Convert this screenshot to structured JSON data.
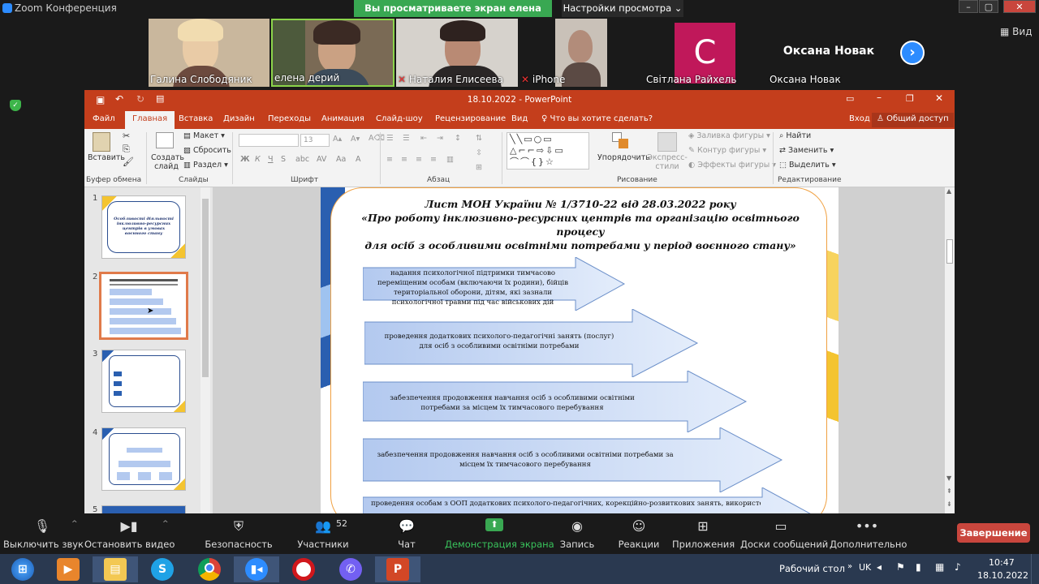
{
  "zoom": {
    "window_title": "Zoom Конференция",
    "share_banner": "Вы просматриваете экран елена дерий",
    "view_settings": "Настройки просмотра ⌄",
    "view_toggle": "Вид",
    "participants": [
      {
        "name": "Галина Слободяник"
      },
      {
        "name": "елена дерий"
      },
      {
        "name": "Наталия Елисеева"
      },
      {
        "name": "iPhone"
      },
      {
        "name": "Світлана Райхель",
        "initial": "С"
      },
      {
        "name": "Оксана Новак",
        "display_name": "Оксана Новак"
      }
    ],
    "toolbar": {
      "mute": "Выключить звук",
      "video": "Остановить видео",
      "security": "Безопасность",
      "participants": "Участники",
      "participants_count": "52",
      "chat": "Чат",
      "share": "Демонстрация экрана",
      "record": "Запись",
      "reactions": "Реакции",
      "apps": "Приложения",
      "whiteboards": "Доски сообщений",
      "more": "Дополнительно",
      "end": "Завершение"
    }
  },
  "powerpoint": {
    "title": "18.10.2022 - PowerPoint",
    "tabs": [
      "Файл",
      "Главная",
      "Вставка",
      "Дизайн",
      "Переходы",
      "Анимация",
      "Слайд-шоу",
      "Рецензирование",
      "Вид"
    ],
    "tell_me": "Что вы хотите сделать?",
    "sign_in": "Вход",
    "share": "Общий доступ",
    "ribbon": {
      "paste": "Вставить",
      "new_slide": "Создать слайд",
      "layout": "Макет",
      "reset": "Сбросить",
      "section": "Раздел",
      "font_size": "13",
      "arrange": "Упорядочить",
      "quick_styles": "Экспресс-стили",
      "shape_fill": "Заливка фигуры",
      "shape_outline": "Контур фигуры",
      "shape_effects": "Эффекты фигуры",
      "find": "Найти",
      "replace": "Заменить",
      "select": "Выделить",
      "groups": {
        "clipboard": "Буфер обмена",
        "slides": "Слайды",
        "font": "Шрифт",
        "paragraph": "Абзац",
        "drawing": "Рисование",
        "editing": "Редактирование"
      }
    },
    "thumbnails": [
      "1",
      "2",
      "3",
      "4",
      "5"
    ],
    "thumb1_text": "Особливості діяльності інклюзивно-ресурсних центрів в умовах воєнного стану",
    "slide": {
      "title_line1": "Лист МОН України № 1/3710-22 від 28.03.2022 року",
      "title_line2": "«Про роботу інклюзивно-ресурсних центрів та організацію освітнього процесу",
      "title_line3": "для осіб з особливими освітніми потребами у період воєнного стану»",
      "arrows": [
        "надання психологічної підтримки тимчасово переміщеним особам (включаючи їх родини), бійців територіальної оборони, дітям, які зазнали психологічної травми під час військових дій",
        "проведення додаткових психолого-педагогічні занять (послуг) для осіб з особливими освітніми потребами",
        "забезпечення продовження навчання осіб з особливими освітніми потребами за місцем їх тимчасового перебування",
        "забезпечення продовження навчання осіб з особливими освітніми потребами за місцем їх тимчасового перебування",
        "проведення особам з ООП додаткових психолого-педагогічних, корекційно-розвиткових занять, використовувати"
      ]
    }
  },
  "taskbar": {
    "desktop_label": "Рабочий стол",
    "language": "UK",
    "time": "10:47",
    "date": "18.10.2022"
  },
  "colors": {
    "ppt_accent": "#c43e1c",
    "zoom_share_green": "#39a852",
    "zoom_blue": "#2d8cff",
    "end_red": "#c9463d",
    "avatar_magenta": "#c0185a"
  }
}
